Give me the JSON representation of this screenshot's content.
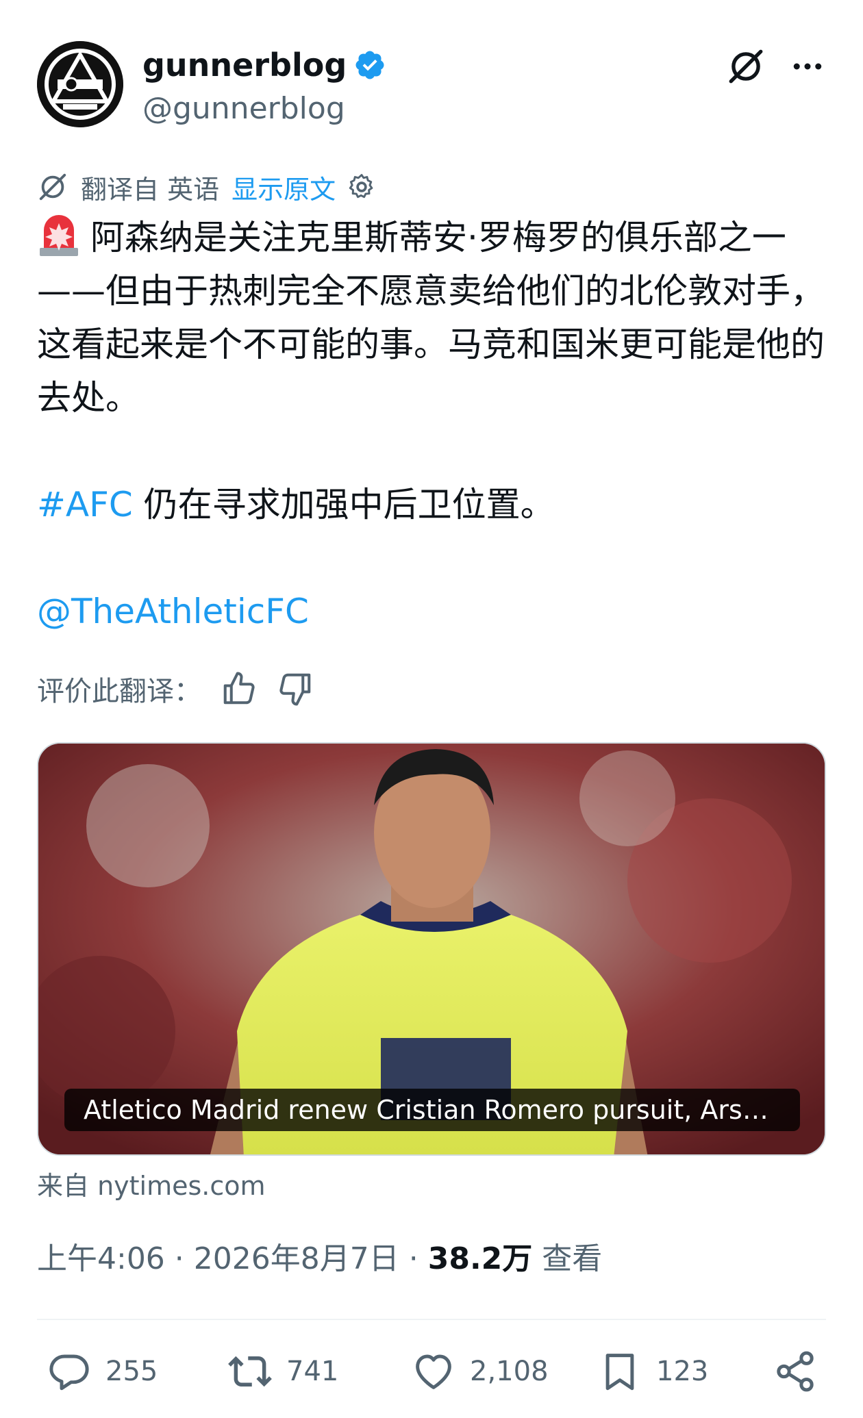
{
  "author": {
    "display_name": "gunnerblog",
    "handle": "@gunnerblog"
  },
  "translation": {
    "translated_from": "翻译自 英语",
    "show_original": "显示原文"
  },
  "tweet": {
    "line1": "阿森纳是关注克里斯蒂安·罗梅罗的俱乐部之一——但由于热刺完全不愿意卖给他们的北伦敦对手，这看起来是个不可能的事。马竞和国米更可能是他的去处。",
    "hashtag": "#AFC",
    "line2": " 仍在寻求加强中后卫位置。",
    "mention": "@TheAthleticFC"
  },
  "rate": {
    "label": "评价此翻译："
  },
  "card": {
    "caption": "Atletico Madrid renew Cristian Romero pursuit, Arsenal interested"
  },
  "source": "来自 nytimes.com",
  "meta": {
    "time": "上午4:06",
    "sep1": " · ",
    "date": "2026年8月7日",
    "sep2": " · ",
    "views_count": "38.2万",
    "views_label": " 查看"
  },
  "actions": {
    "replies": "255",
    "reposts": "741",
    "likes": "2,108",
    "bookmarks": "123"
  },
  "colors": {
    "accent": "#1d9bf0",
    "secondary_text": "#536471",
    "primary_text": "#0f1419"
  }
}
